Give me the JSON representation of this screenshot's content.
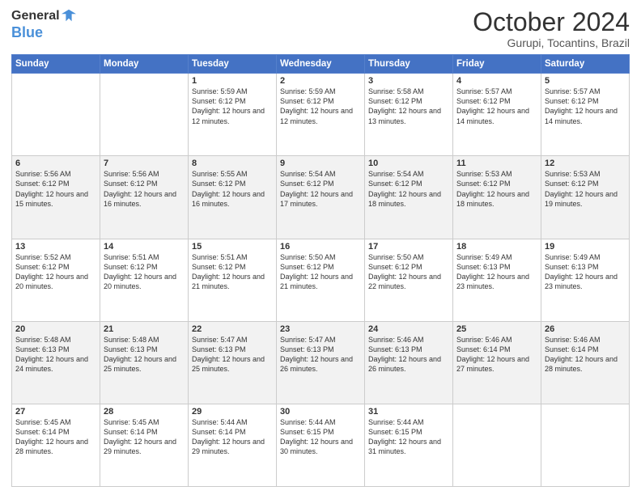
{
  "header": {
    "logo_general": "General",
    "logo_blue": "Blue",
    "month_title": "October 2024",
    "location": "Gurupi, Tocantins, Brazil"
  },
  "days_of_week": [
    "Sunday",
    "Monday",
    "Tuesday",
    "Wednesday",
    "Thursday",
    "Friday",
    "Saturday"
  ],
  "weeks": [
    [
      {
        "day": "",
        "info": ""
      },
      {
        "day": "",
        "info": ""
      },
      {
        "day": "1",
        "info": "Sunrise: 5:59 AM\nSunset: 6:12 PM\nDaylight: 12 hours and 12 minutes."
      },
      {
        "day": "2",
        "info": "Sunrise: 5:59 AM\nSunset: 6:12 PM\nDaylight: 12 hours and 12 minutes."
      },
      {
        "day": "3",
        "info": "Sunrise: 5:58 AM\nSunset: 6:12 PM\nDaylight: 12 hours and 13 minutes."
      },
      {
        "day": "4",
        "info": "Sunrise: 5:57 AM\nSunset: 6:12 PM\nDaylight: 12 hours and 14 minutes."
      },
      {
        "day": "5",
        "info": "Sunrise: 5:57 AM\nSunset: 6:12 PM\nDaylight: 12 hours and 14 minutes."
      }
    ],
    [
      {
        "day": "6",
        "info": "Sunrise: 5:56 AM\nSunset: 6:12 PM\nDaylight: 12 hours and 15 minutes."
      },
      {
        "day": "7",
        "info": "Sunrise: 5:56 AM\nSunset: 6:12 PM\nDaylight: 12 hours and 16 minutes."
      },
      {
        "day": "8",
        "info": "Sunrise: 5:55 AM\nSunset: 6:12 PM\nDaylight: 12 hours and 16 minutes."
      },
      {
        "day": "9",
        "info": "Sunrise: 5:54 AM\nSunset: 6:12 PM\nDaylight: 12 hours and 17 minutes."
      },
      {
        "day": "10",
        "info": "Sunrise: 5:54 AM\nSunset: 6:12 PM\nDaylight: 12 hours and 18 minutes."
      },
      {
        "day": "11",
        "info": "Sunrise: 5:53 AM\nSunset: 6:12 PM\nDaylight: 12 hours and 18 minutes."
      },
      {
        "day": "12",
        "info": "Sunrise: 5:53 AM\nSunset: 6:12 PM\nDaylight: 12 hours and 19 minutes."
      }
    ],
    [
      {
        "day": "13",
        "info": "Sunrise: 5:52 AM\nSunset: 6:12 PM\nDaylight: 12 hours and 20 minutes."
      },
      {
        "day": "14",
        "info": "Sunrise: 5:51 AM\nSunset: 6:12 PM\nDaylight: 12 hours and 20 minutes."
      },
      {
        "day": "15",
        "info": "Sunrise: 5:51 AM\nSunset: 6:12 PM\nDaylight: 12 hours and 21 minutes."
      },
      {
        "day": "16",
        "info": "Sunrise: 5:50 AM\nSunset: 6:12 PM\nDaylight: 12 hours and 21 minutes."
      },
      {
        "day": "17",
        "info": "Sunrise: 5:50 AM\nSunset: 6:12 PM\nDaylight: 12 hours and 22 minutes."
      },
      {
        "day": "18",
        "info": "Sunrise: 5:49 AM\nSunset: 6:13 PM\nDaylight: 12 hours and 23 minutes."
      },
      {
        "day": "19",
        "info": "Sunrise: 5:49 AM\nSunset: 6:13 PM\nDaylight: 12 hours and 23 minutes."
      }
    ],
    [
      {
        "day": "20",
        "info": "Sunrise: 5:48 AM\nSunset: 6:13 PM\nDaylight: 12 hours and 24 minutes."
      },
      {
        "day": "21",
        "info": "Sunrise: 5:48 AM\nSunset: 6:13 PM\nDaylight: 12 hours and 25 minutes."
      },
      {
        "day": "22",
        "info": "Sunrise: 5:47 AM\nSunset: 6:13 PM\nDaylight: 12 hours and 25 minutes."
      },
      {
        "day": "23",
        "info": "Sunrise: 5:47 AM\nSunset: 6:13 PM\nDaylight: 12 hours and 26 minutes."
      },
      {
        "day": "24",
        "info": "Sunrise: 5:46 AM\nSunset: 6:13 PM\nDaylight: 12 hours and 26 minutes."
      },
      {
        "day": "25",
        "info": "Sunrise: 5:46 AM\nSunset: 6:14 PM\nDaylight: 12 hours and 27 minutes."
      },
      {
        "day": "26",
        "info": "Sunrise: 5:46 AM\nSunset: 6:14 PM\nDaylight: 12 hours and 28 minutes."
      }
    ],
    [
      {
        "day": "27",
        "info": "Sunrise: 5:45 AM\nSunset: 6:14 PM\nDaylight: 12 hours and 28 minutes."
      },
      {
        "day": "28",
        "info": "Sunrise: 5:45 AM\nSunset: 6:14 PM\nDaylight: 12 hours and 29 minutes."
      },
      {
        "day": "29",
        "info": "Sunrise: 5:44 AM\nSunset: 6:14 PM\nDaylight: 12 hours and 29 minutes."
      },
      {
        "day": "30",
        "info": "Sunrise: 5:44 AM\nSunset: 6:15 PM\nDaylight: 12 hours and 30 minutes."
      },
      {
        "day": "31",
        "info": "Sunrise: 5:44 AM\nSunset: 6:15 PM\nDaylight: 12 hours and 31 minutes."
      },
      {
        "day": "",
        "info": ""
      },
      {
        "day": "",
        "info": ""
      }
    ]
  ]
}
